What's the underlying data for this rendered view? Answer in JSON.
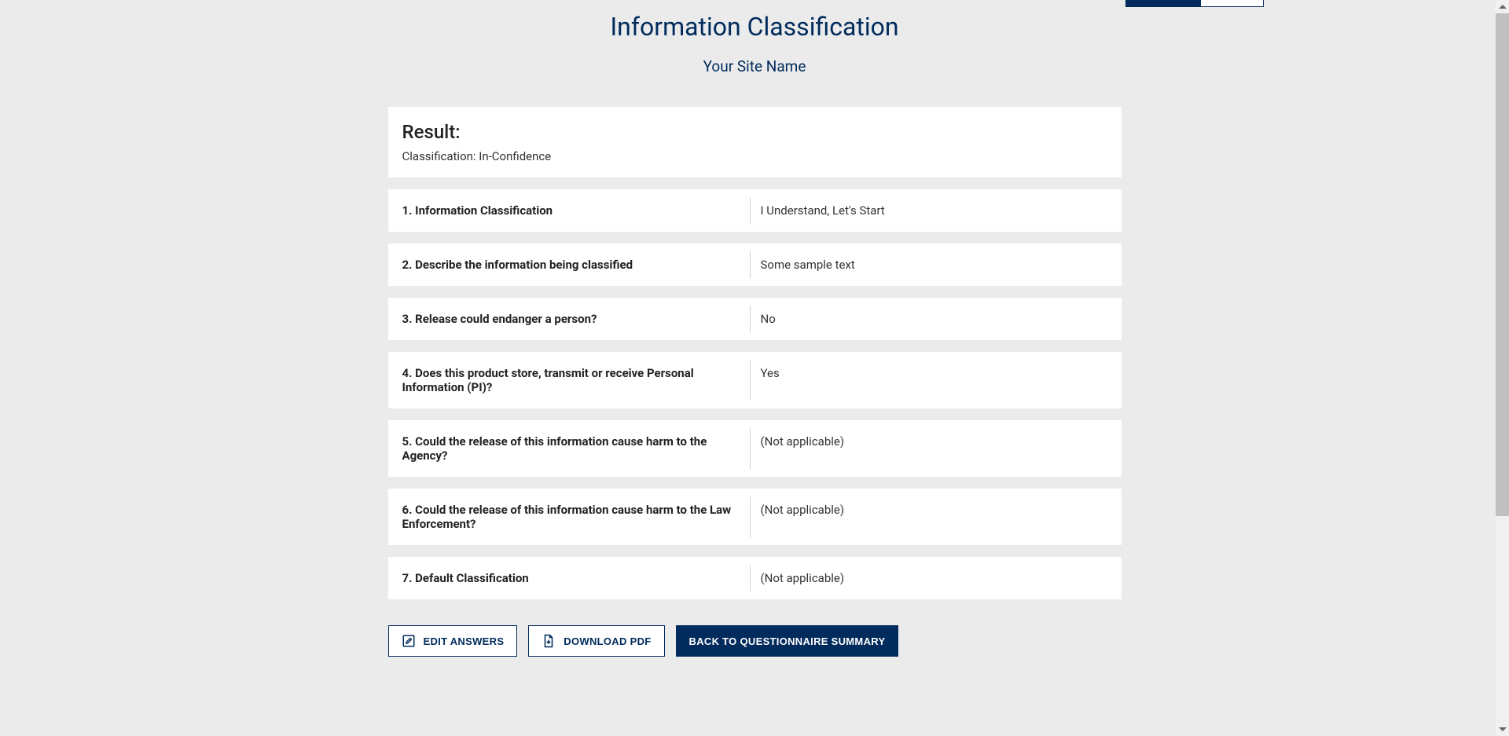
{
  "header": {
    "title": "Information Classification",
    "site_name": "Your Site Name"
  },
  "result": {
    "heading": "Result:",
    "value": "Classification: In-Confidence"
  },
  "questions": [
    {
      "label": "1. Information Classification",
      "answer": "I Understand, Let's Start"
    },
    {
      "label": "2. Describe the information being classified",
      "answer": "Some sample text"
    },
    {
      "label": "3. Release could endanger a person?",
      "answer": "No"
    },
    {
      "label": "4. Does this product store, transmit or receive Personal Information (PI)?",
      "answer": "Yes"
    },
    {
      "label": "5. Could the release of this information cause harm to the Agency?",
      "answer": "(Not applicable)"
    },
    {
      "label": "6. Could the release of this information cause harm to the Law Enforcement?",
      "answer": "(Not applicable)"
    },
    {
      "label": "7. Default Classification",
      "answer": "(Not applicable)"
    }
  ],
  "actions": {
    "edit": "EDIT ANSWERS",
    "download": "DOWNLOAD PDF",
    "back": "BACK TO QUESTIONNAIRE SUMMARY"
  }
}
